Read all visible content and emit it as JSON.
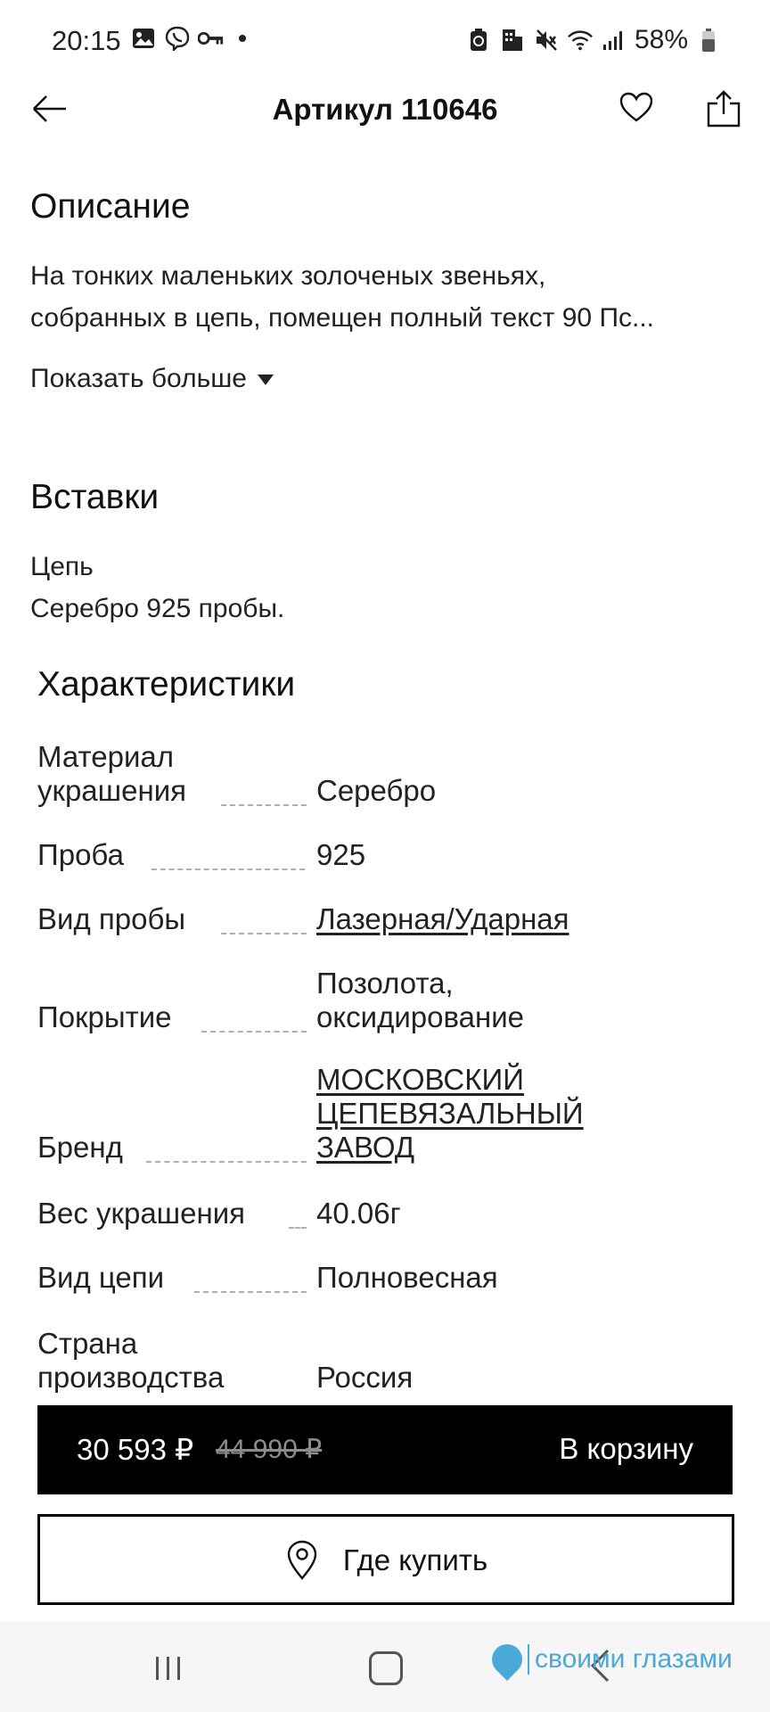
{
  "status_bar": {
    "time": "20:15",
    "battery": "58%",
    "icons_left": [
      "gallery-icon",
      "viber-icon",
      "key-icon"
    ],
    "icons_right": [
      "battery-saver-icon",
      "building-icon",
      "mute-icon",
      "wifi-icon",
      "signal-icon"
    ]
  },
  "header": {
    "title": "Артикул 110646"
  },
  "description": {
    "title": "Описание",
    "line1": "На тонких маленьких золоченых звеньях,",
    "line2": "собранных в цепь, помещен полный текст 90 Пс...",
    "show_more": "Показать больше"
  },
  "inserts": {
    "title": "Вставки",
    "line1": "Цепь",
    "line2": "Серебро 925 пробы."
  },
  "characteristics": {
    "title": "Характеристики",
    "rows": [
      {
        "label1": "Материал",
        "label2": "украшения",
        "value1": "Серебро",
        "value2": ""
      },
      {
        "label1": "Проба",
        "label2": "",
        "value1": "925",
        "value2": ""
      },
      {
        "label1": "Вид пробы",
        "label2": "",
        "value1": "Лазерная/Ударная",
        "value2": ""
      },
      {
        "label1": "Покрытие",
        "label2": "",
        "value1": "Позолота,",
        "value2": "оксидирование"
      },
      {
        "label1": "Бренд",
        "label2": "",
        "value1": "МОСКОВСКИЙ",
        "value2": "ЦЕПЕВЯЗАЛЬНЫЙ",
        "value3": "ЗАВОД"
      },
      {
        "label1": "Вес украшения",
        "label2": "",
        "value1": "40.06г",
        "value2": ""
      },
      {
        "label1": "Вид цепи",
        "label2": "",
        "value1": "Полновесная",
        "value2": ""
      },
      {
        "label1": "Страна",
        "label2": "производства",
        "value1": "Россия",
        "value2": ""
      }
    ]
  },
  "buy_bar": {
    "price": "30 593 ₽",
    "old_price": "44 990 ₽",
    "cart_label": "В корзину"
  },
  "where_to_buy": {
    "label": "Где купить"
  },
  "watermark": "своими глазами",
  "colors": {
    "primary": "#000000",
    "background": "#ffffff",
    "watermark": "#4aa9d8",
    "old_price": "#8c8c8c"
  }
}
